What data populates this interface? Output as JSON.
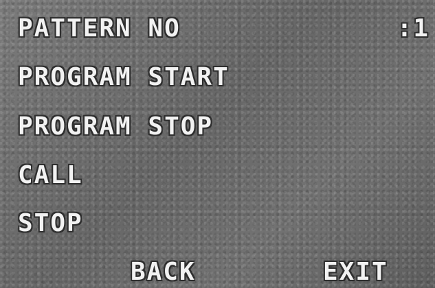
{
  "menu": {
    "pattern_no_label": "PATTERN NO",
    "pattern_no_value": ":1",
    "program_start": "PROGRAM START",
    "program_stop": "PROGRAM STOP",
    "call": "CALL",
    "stop": "STOP"
  },
  "footer": {
    "back": "BACK",
    "exit": "EXIT"
  }
}
